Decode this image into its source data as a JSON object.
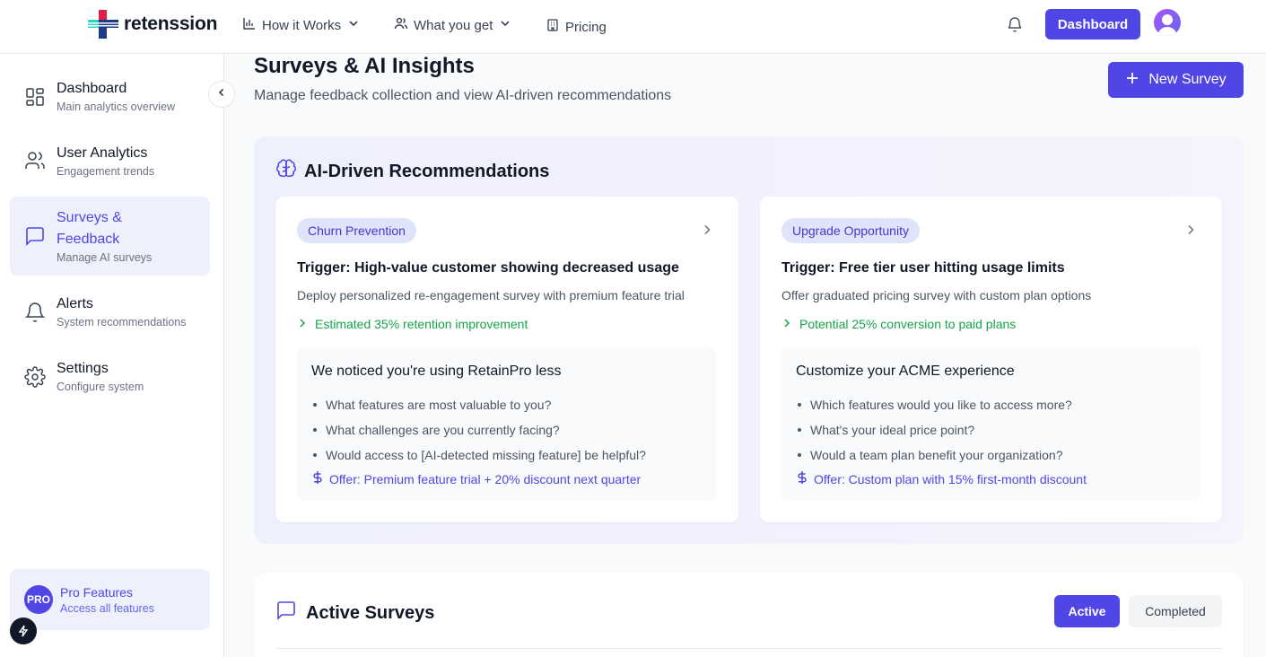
{
  "brand": {
    "name": "retenssion",
    "accent": "#4f46e5"
  },
  "topnav": {
    "links": [
      {
        "label": "How it Works",
        "icon": "bar-chart-icon",
        "has_caret": true
      },
      {
        "label": "What you get",
        "icon": "users-icon",
        "has_caret": true
      },
      {
        "label": "Pricing",
        "icon": "building-icon",
        "has_caret": false
      }
    ],
    "dashboard_label": "Dashboard"
  },
  "sidebar": {
    "items": [
      {
        "title": "Dashboard",
        "sub": "Main analytics overview",
        "icon": "grid-icon"
      },
      {
        "title": "User Analytics",
        "sub": "Engagement trends",
        "icon": "users-icon"
      },
      {
        "title": "Surveys & Feedback",
        "sub": "Manage AI surveys",
        "icon": "message-square-icon",
        "active": true
      },
      {
        "title": "Alerts",
        "sub": "System recommendations",
        "icon": "bell-icon"
      },
      {
        "title": "Settings",
        "sub": "Configure system",
        "icon": "gear-icon"
      }
    ],
    "pro": {
      "badge": "PRO",
      "title": "Pro Features",
      "sub": "Access all features"
    }
  },
  "main": {
    "title": "Surveys & AI Insights",
    "subtitle": "Manage feedback collection and view AI-driven recommendations",
    "new_survey_label": "New Survey",
    "ai_section": {
      "title": "AI-Driven Recommendations",
      "cards": [
        {
          "tag": "Churn Prevention",
          "trigger": "Trigger: High-value customer showing decreased usage",
          "description": "Deploy personalized re-engagement survey with premium feature trial",
          "estimate": "Estimated 35% retention improvement",
          "survey_title": "We noticed you're using RetainPro less",
          "questions": [
            "What features are most valuable to you?",
            "What challenges are you currently facing?",
            "Would access to [AI-detected missing feature] be helpful?"
          ],
          "offer": "Offer: Premium feature trial + 20% discount next quarter"
        },
        {
          "tag": "Upgrade Opportunity",
          "trigger": "Trigger: Free tier user hitting usage limits",
          "description": "Offer graduated pricing survey with custom plan options",
          "estimate": "Potential 25% conversion to paid plans",
          "survey_title": "Customize your ACME experience",
          "questions": [
            "Which features would you like to access more?",
            "What's your ideal price point?",
            "Would a team plan benefit your organization?"
          ],
          "offer": "Offer: Custom plan with 15% first-month discount"
        }
      ]
    },
    "active_surveys": {
      "title": "Active Surveys",
      "tabs": [
        "Active",
        "Completed"
      ]
    }
  }
}
